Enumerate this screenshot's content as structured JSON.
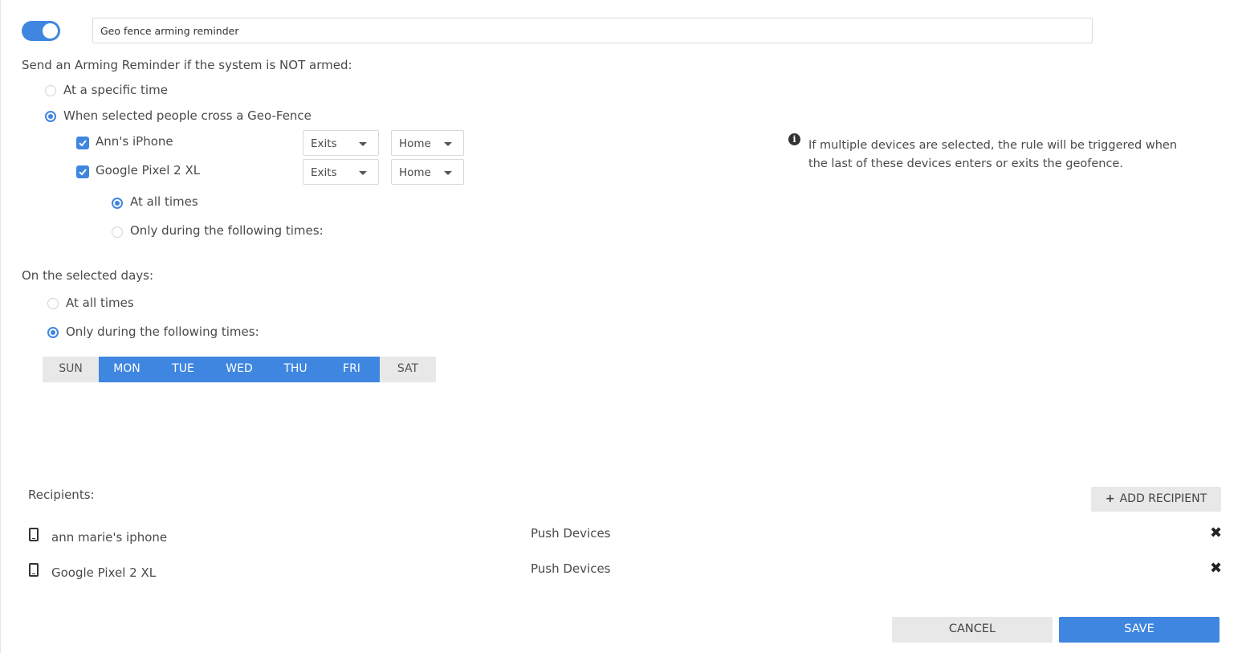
{
  "rule": {
    "enabled": true,
    "name_value": "Geo fence arming reminder"
  },
  "reminder": {
    "heading": "Send an Arming Reminder if the system is NOT armed:",
    "options": [
      {
        "label": "At a specific time",
        "selected": false
      },
      {
        "label": "When selected people cross a Geo-Fence",
        "selected": true
      }
    ],
    "devices": [
      {
        "label": "Ann's iPhone",
        "checked": true,
        "action": "Exits",
        "location": "Home"
      },
      {
        "label": "Google Pixel 2 XL",
        "checked": true,
        "action": "Exits",
        "location": "Home"
      }
    ],
    "time_options": [
      {
        "label": "At all times",
        "selected": true
      },
      {
        "label": "Only during the following times:",
        "selected": false
      }
    ]
  },
  "info": {
    "icon": "info-icon",
    "text": "If multiple devices are selected, the rule will be triggered when the last of these devices enters or exits the geofence."
  },
  "days_section": {
    "heading": "On the selected days:",
    "options": [
      {
        "label": "At all times",
        "selected": false
      },
      {
        "label": "Only during the following times:",
        "selected": true
      }
    ],
    "days": [
      {
        "label": "SUN",
        "selected": false
      },
      {
        "label": "MON",
        "selected": true
      },
      {
        "label": "TUE",
        "selected": true
      },
      {
        "label": "WED",
        "selected": true
      },
      {
        "label": "THU",
        "selected": true
      },
      {
        "label": "FRI",
        "selected": true
      },
      {
        "label": "SAT",
        "selected": false
      }
    ]
  },
  "recipients": {
    "heading": "Recipients:",
    "add_label": "ADD RECIPIENT",
    "items": [
      {
        "name": "ann marie's iphone",
        "type": "Push Devices",
        "icon": "phone-icon"
      },
      {
        "name": "Google Pixel 2 XL",
        "type": "Push Devices",
        "icon": "phone-icon"
      }
    ]
  },
  "footer": {
    "cancel_label": "CANCEL",
    "save_label": "SAVE"
  },
  "colors": {
    "accent": "#3f86e0",
    "button_gray": "#e8e8e8",
    "text": "#4a4a4a"
  }
}
